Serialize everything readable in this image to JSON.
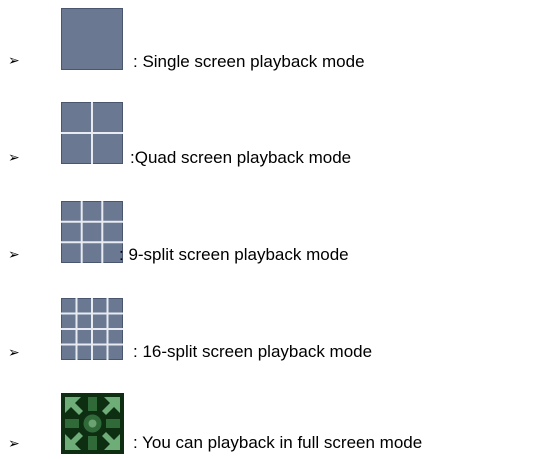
{
  "bullet_glyph": "➢",
  "items": [
    {
      "icon": "single-screen-icon",
      "text": ": Single screen playback mode"
    },
    {
      "icon": "quad-screen-icon",
      "text": ":Quad screen playback mode"
    },
    {
      "icon": "nine-split-screen-icon",
      "text": ": 9-split screen playback mode"
    },
    {
      "icon": "sixteen-split-screen-icon",
      "text": ": 16-split screen playback mode"
    },
    {
      "icon": "full-screen-icon",
      "text": ": You can playback in full screen mode"
    }
  ],
  "colors": {
    "tile_fill": "#6a7892",
    "tile_border": "#4a5670",
    "grid_line": "#e8ecf2",
    "fullscreen_dark": "#0e2e12",
    "fullscreen_light": "#7fc28a"
  }
}
